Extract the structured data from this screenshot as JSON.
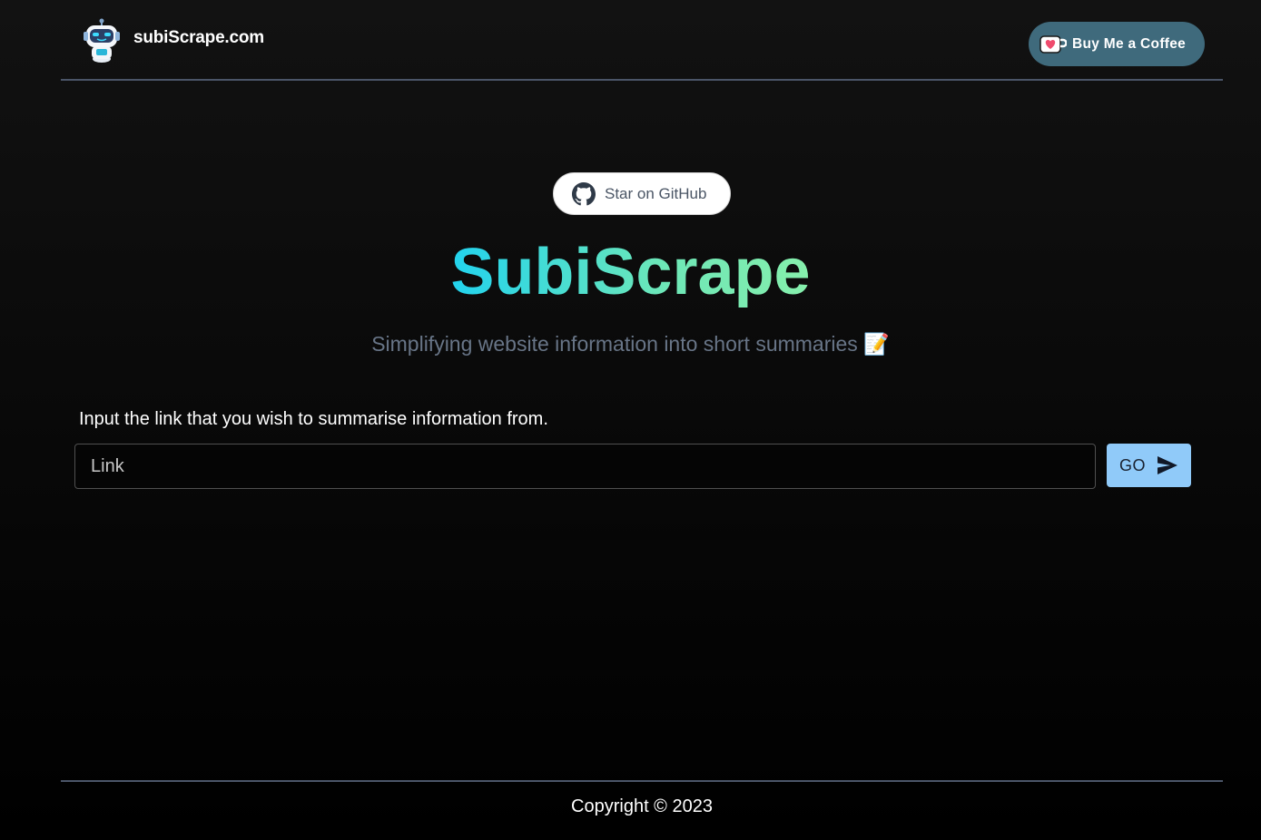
{
  "header": {
    "site_name": "subiScrape.com",
    "logo_icon": "robot-icon",
    "coffee_label": "Buy Me a Coffee",
    "coffee_icon": "coffee-cup-icon",
    "coffee_color": "#3f6a7c"
  },
  "hero": {
    "github_label": "Star on GitHub",
    "github_icon": "github-icon",
    "title": "SubiScrape",
    "subtitle": "Simplifying website information into short summaries",
    "subtitle_emoji": "📝",
    "title_gradient": [
      "#22d3ee",
      "#86efac"
    ]
  },
  "form": {
    "label": "Input the link that you wish to summarise information from.",
    "input_placeholder": "Link",
    "input_value": "",
    "go_label": "GO",
    "go_icon": "send-icon",
    "go_color": "#90caf9"
  },
  "footer": {
    "copyright": "Copyright © 2023"
  }
}
